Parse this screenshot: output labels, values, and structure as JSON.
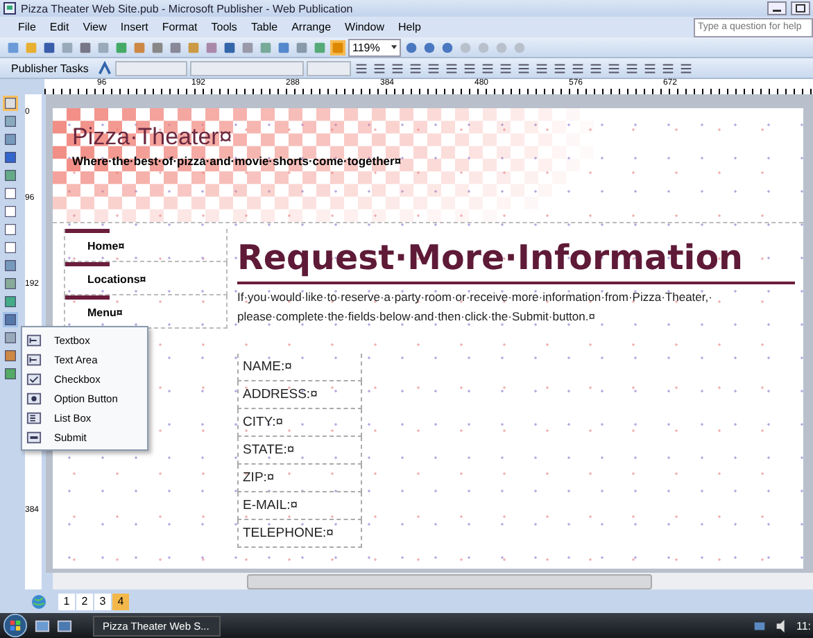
{
  "window": {
    "title": "Pizza Theater Web Site.pub - Microsoft Publisher - Web Publication"
  },
  "menu": [
    "File",
    "Edit",
    "View",
    "Insert",
    "Format",
    "Tools",
    "Table",
    "Arrange",
    "Window",
    "Help"
  ],
  "help_box": {
    "placeholder": "Type a question for help"
  },
  "toolbar": {
    "zoom": "119%"
  },
  "format_toolbar": {
    "tasks_button": "Publisher Tasks"
  },
  "ruler": {
    "marks": [
      "96",
      "192",
      "288",
      "384",
      "480",
      "576",
      "672"
    ]
  },
  "vertical_ruler": {
    "marks": [
      "0",
      "96",
      "192",
      "384"
    ]
  },
  "page": {
    "title": "Pizza·Theater¤",
    "tagline": "Where·the·best·of·pizza·and·movie·shorts·come·together¤",
    "nav": [
      {
        "label": "Home¤"
      },
      {
        "label": "Locations¤"
      },
      {
        "label": "Menu¤"
      }
    ],
    "heading": "Request·More·Information",
    "intro": "If·you·would·like·to·reserve·a·party·room·or·receive·more·information·from·Pizza·Theater,·\nplease·complete·the·fields·below·and·then·click·the·Submit·button.¤",
    "fields": [
      "NAME:¤",
      "ADDRESS:¤",
      "CITY:¤",
      "STATE:¤",
      "ZIP:¤",
      "E-MAIL:¤",
      "TELEPHONE:¤"
    ]
  },
  "form_control_menu": [
    {
      "label": "Textbox",
      "kind": "textbox"
    },
    {
      "label": "Text Area",
      "kind": "textarea"
    },
    {
      "label": "Checkbox",
      "kind": "checkbox"
    },
    {
      "label": "Option Button",
      "kind": "option"
    },
    {
      "label": "List Box",
      "kind": "listbox"
    },
    {
      "label": "Submit",
      "kind": "submit"
    }
  ],
  "page_tabs": [
    {
      "label": "1",
      "selected": false
    },
    {
      "label": "2",
      "selected": false
    },
    {
      "label": "3",
      "selected": false
    },
    {
      "label": "4",
      "selected": true
    }
  ],
  "taskbar": {
    "button": "Pizza Theater Web S...",
    "clock": "11:"
  }
}
